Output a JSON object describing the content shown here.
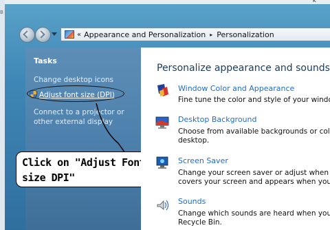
{
  "window": {
    "corner_fragment": "B",
    "top_fragment": "k"
  },
  "nav": {
    "breadcrumb_chevrons": "«",
    "crumb_1": "Appearance and Personalization",
    "separator": "▸",
    "crumb_2": "Personalization"
  },
  "tasks": {
    "title": "Tasks",
    "items": [
      {
        "label": "Change desktop icons"
      },
      {
        "label": "Adjust font size (DPI)"
      },
      {
        "label": "Connect to a projector or other external display"
      }
    ]
  },
  "callout": {
    "text": "Click on \"Adjust Font size DPI\""
  },
  "main": {
    "title": "Personalize appearance and sounds",
    "items": [
      {
        "link": "Window Color and Appearance",
        "desc_lines": [
          "Fine tune the color and style of your windows"
        ],
        "icon": "window-color-icon"
      },
      {
        "link": "Desktop Background",
        "desc_lines": [
          "Choose from available backgrounds or colors",
          "desktop."
        ],
        "icon": "desktop-background-icon"
      },
      {
        "link": "Screen Saver",
        "desc_lines": [
          "Change your screen saver or adjust when it di",
          "covers your screen and appears when your co"
        ],
        "icon": "screen-saver-icon"
      },
      {
        "link": "Sounds",
        "desc_lines": [
          "Change which sounds are heard when you do",
          "Recycle Bin."
        ],
        "icon": "sounds-icon"
      }
    ]
  },
  "colors": {
    "taskpane": "#4d80ac",
    "link": "#1f6ccb",
    "title": "#1c3a5a"
  }
}
